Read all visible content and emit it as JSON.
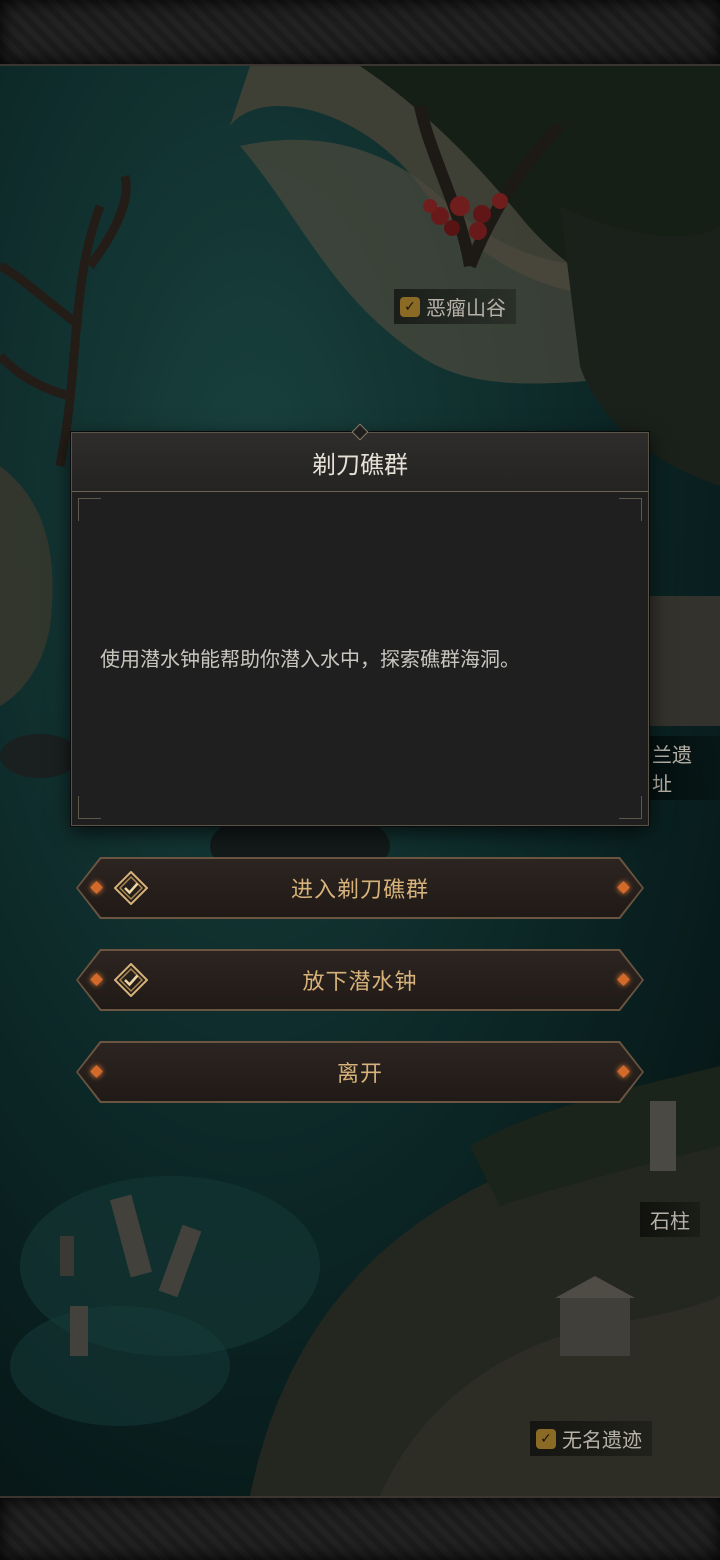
{
  "map": {
    "locations": [
      {
        "name": "恶瘤山谷",
        "checked": true
      },
      {
        "name": "兰遗址",
        "checked": false
      },
      {
        "name": "石柱",
        "checked": false
      },
      {
        "name": "无名遗迹",
        "checked": true
      }
    ]
  },
  "dialog": {
    "title": "剃刀礁群",
    "description": "使用潜水钟能帮助你潜入水中，探索礁群海洞。"
  },
  "options": [
    {
      "label": "进入剃刀礁群",
      "icon": "diamond-check-icon"
    },
    {
      "label": "放下潜水钟",
      "icon": "diamond-check-icon"
    },
    {
      "label": "离开",
      "icon": ""
    }
  ],
  "colors": {
    "accent_gold": "#d7b27a",
    "gem_orange": "#d46a2a",
    "panel_bg": "#1f1f1f"
  }
}
